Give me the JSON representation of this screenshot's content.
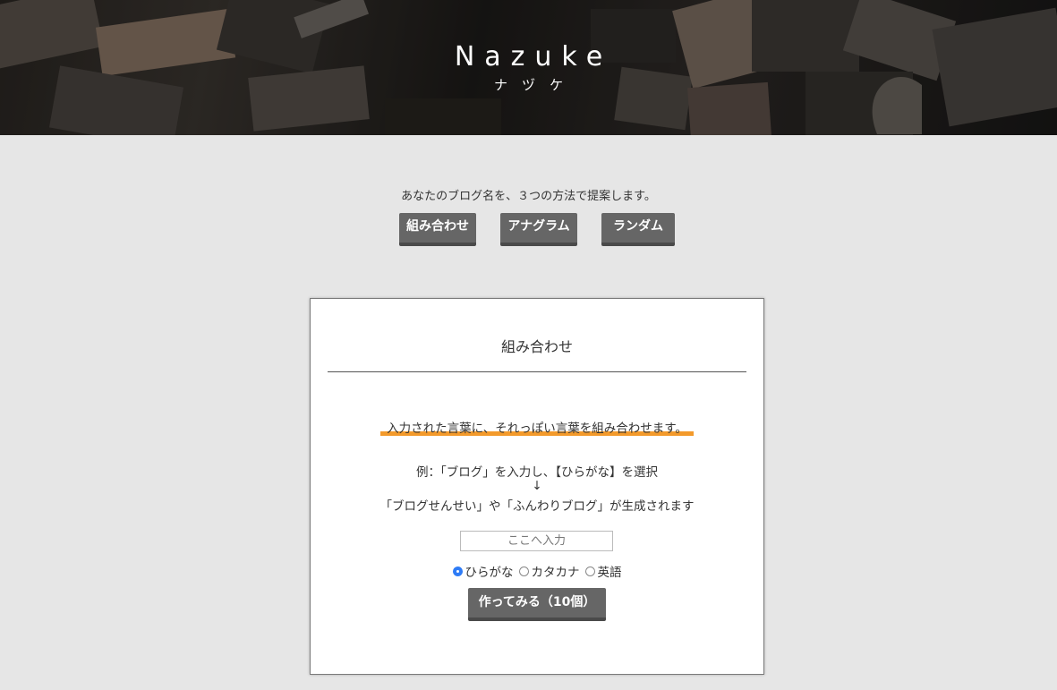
{
  "header": {
    "title": "Nazuke",
    "subtitle": "ナヅケ"
  },
  "intro": {
    "text": "あなたのブログ名を、３つの方法で提案します。",
    "modes": [
      "組み合わせ",
      "アナグラム",
      "ランダム"
    ]
  },
  "card": {
    "title": "組み合わせ",
    "lead": "入力された言葉に、それっぽい言葉を組み合わせます。",
    "example_line1": "例：「ブログ」を入力し、【ひらがな】を選択",
    "example_arrow": "↓",
    "example_line2": "「ブログせんせい」や「ふんわりブログ」が生成されます",
    "input": {
      "placeholder": "ここへ入力",
      "value": ""
    },
    "radio_options": [
      {
        "label": "ひらがな",
        "selected": true
      },
      {
        "label": "カタカナ",
        "selected": false
      },
      {
        "label": "英語",
        "selected": false
      }
    ],
    "submit_label": "作ってみる（10個）"
  },
  "colors": {
    "background": "#e6e6e6",
    "button": "#666666",
    "accent_underline": "#f39a2b",
    "radio_selected": "#2f7cf6"
  }
}
